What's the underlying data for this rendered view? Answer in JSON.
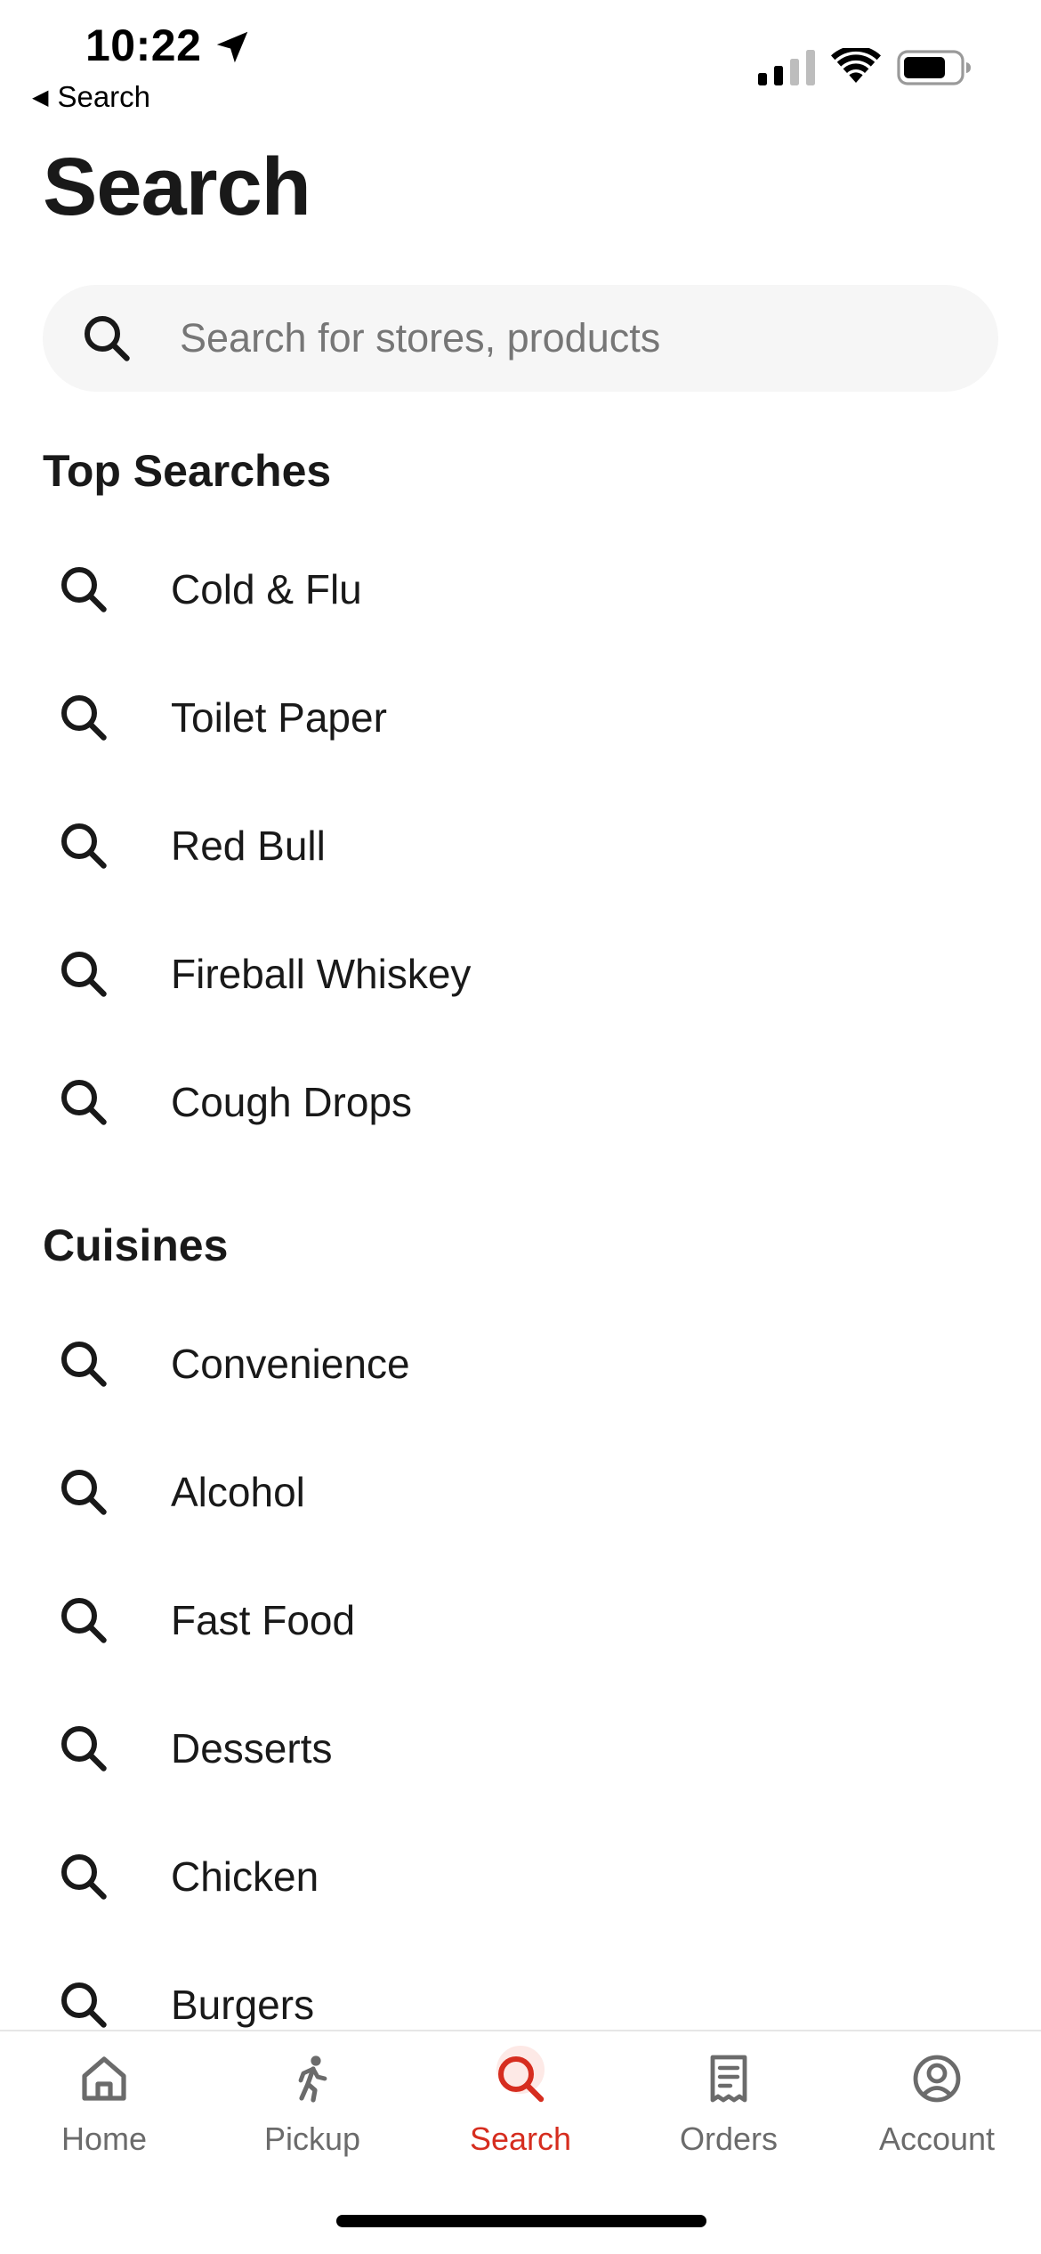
{
  "status_bar": {
    "time": "10:22",
    "back_label": "Search",
    "icons": [
      "location-arrow-icon",
      "cellular-signal-icon",
      "wifi-icon",
      "battery-icon"
    ]
  },
  "page": {
    "title": "Search"
  },
  "search": {
    "placeholder": "Search for stores, products",
    "value": "",
    "icon": "search-icon"
  },
  "top_searches": {
    "heading": "Top Searches",
    "items": [
      {
        "label": "Cold & Flu"
      },
      {
        "label": "Toilet Paper"
      },
      {
        "label": "Red Bull"
      },
      {
        "label": "Fireball Whiskey"
      },
      {
        "label": "Cough Drops"
      }
    ]
  },
  "cuisines": {
    "heading": "Cuisines",
    "items": [
      {
        "label": "Convenience"
      },
      {
        "label": "Alcohol"
      },
      {
        "label": "Fast Food"
      },
      {
        "label": "Desserts"
      },
      {
        "label": "Chicken"
      },
      {
        "label": "Burgers"
      }
    ]
  },
  "tab_bar": {
    "active": "Search",
    "accent_color": "#d62d1f",
    "inactive_color": "#6b6b6b",
    "tabs": [
      {
        "label": "Home",
        "icon": "home-icon"
      },
      {
        "label": "Pickup",
        "icon": "walking-person-icon"
      },
      {
        "label": "Search",
        "icon": "search-icon"
      },
      {
        "label": "Orders",
        "icon": "receipt-icon"
      },
      {
        "label": "Account",
        "icon": "account-circle-icon"
      }
    ]
  }
}
